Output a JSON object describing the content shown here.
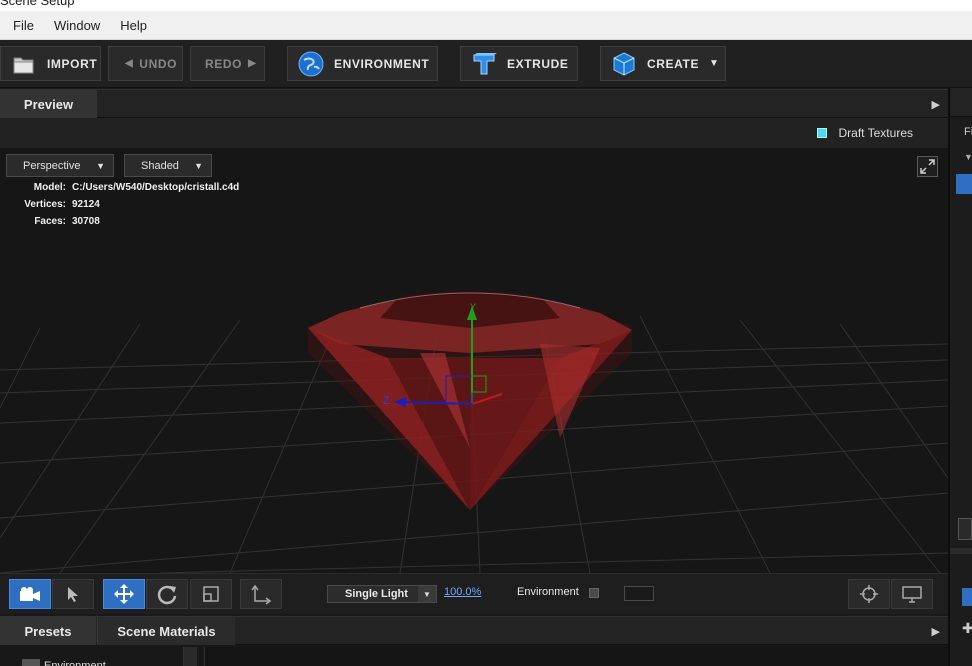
{
  "window": {
    "title": "Scene Setup"
  },
  "menu": [
    {
      "label": "File"
    },
    {
      "label": "Window"
    },
    {
      "label": "Help"
    }
  ],
  "toolbar": {
    "import": "IMPORT",
    "undo": "UNDO",
    "redo": "REDO",
    "environment": "ENVIRONMENT",
    "extrude": "EXTRUDE",
    "create": "CREATE"
  },
  "preview_panel": {
    "tab": "Preview",
    "draft_textures": "Draft Textures",
    "draft_textures_checked": true,
    "view_mode": "Perspective",
    "shading_mode": "Shaded",
    "info": {
      "model_label": "Model:",
      "model_value": "C:/Users/W540/Desktop/cristall.c4d",
      "vertices_label": "Vertices:",
      "vertices_value": "92124",
      "faces_label": "Faces:",
      "faces_value": "30708"
    },
    "axes": {
      "y": "Y",
      "z": "Z"
    }
  },
  "viewport_toolbar": {
    "light_mode": "Single Light",
    "zoom": "100.0%",
    "environment_label": "Environment",
    "environment_checked": false
  },
  "bottom_panel": {
    "tabs": [
      {
        "label": "Presets"
      },
      {
        "label": "Scene Materials"
      }
    ],
    "tree_partial": "Environment"
  },
  "right_panel": {
    "header_partial": "Fi"
  },
  "colors": {
    "accent": "#2f6fc2",
    "gem": "#8e1d1d",
    "link": "#6ea8ff"
  }
}
